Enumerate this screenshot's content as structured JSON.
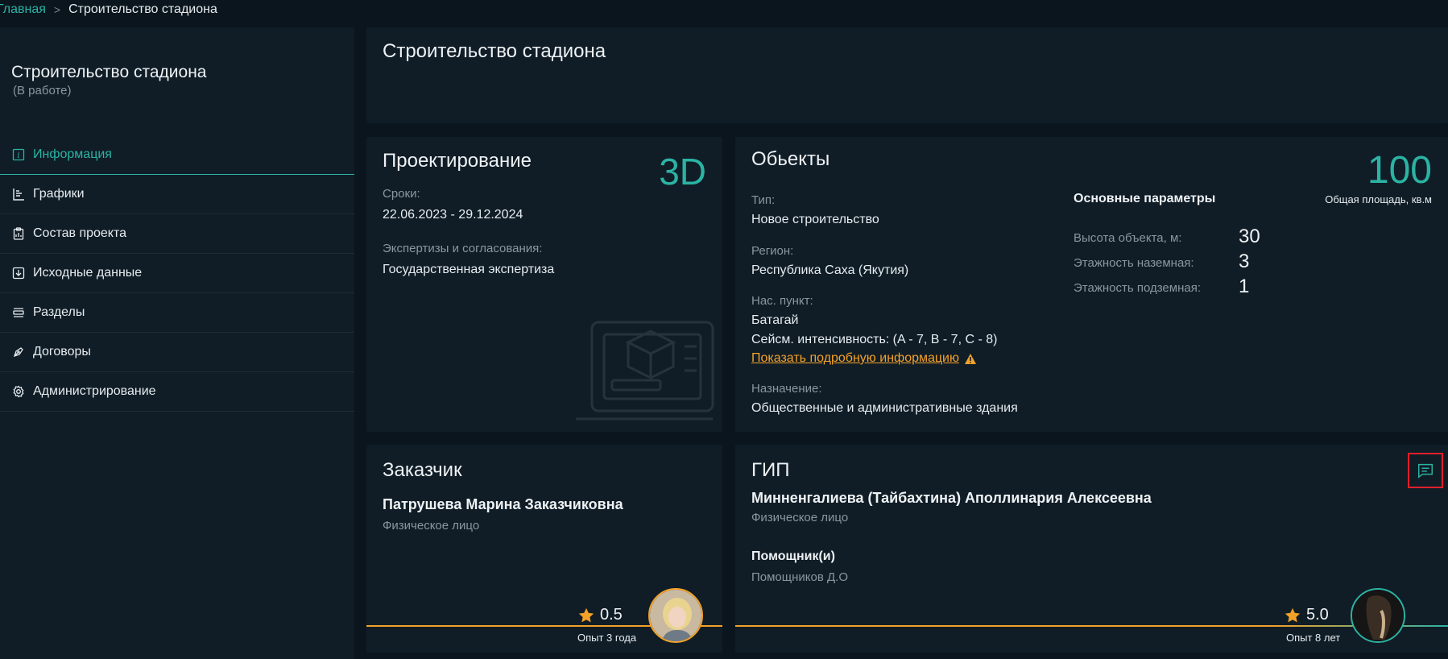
{
  "breadcrumb": {
    "home": "Главная",
    "separator": ">",
    "current": "Строительство стадиона"
  },
  "sidebar": {
    "title": "Строительство стадиона",
    "status": "(В работе)",
    "items": [
      {
        "label": "Информация",
        "icon": "info-icon"
      },
      {
        "label": "Графики",
        "icon": "gantt-icon"
      },
      {
        "label": "Состав проекта",
        "icon": "clipboard-icon"
      },
      {
        "label": "Исходные данные",
        "icon": "download-icon"
      },
      {
        "label": "Разделы",
        "icon": "layers-icon"
      },
      {
        "label": "Договоры",
        "icon": "pen-icon"
      },
      {
        "label": "Администрирование",
        "icon": "gear-icon"
      }
    ]
  },
  "header_card": {
    "title": "Строительство стадиона"
  },
  "design": {
    "title": "Проектирование",
    "badge": "3D",
    "dates_label": "Сроки:",
    "dates": "22.06.2023 - 29.12.2024",
    "expertise_label": "Экспертизы и согласования:",
    "expertise": "Государственная экспертиза"
  },
  "objects": {
    "title": "Обьекты",
    "area_value": "100",
    "area_label": "Общая площадь, кв.м",
    "type_label": "Тип:",
    "type": "Новое строительство",
    "region_label": "Регион:",
    "region": "Республика Саха (Якутия)",
    "settlement_label": "Нас. пункт:",
    "settlement": "Батагай",
    "seismic": "Сейсм. интенсивность: (A - 7, B - 7, C - 8)",
    "details_link": "Показать подробную информацию",
    "purpose_label": "Назначение:",
    "purpose": "Общественные и административные здания",
    "params_title": "Основные параметры",
    "params": [
      {
        "label": "Высота объекта, м:",
        "value": "30"
      },
      {
        "label": "Этажность наземная:",
        "value": "3"
      },
      {
        "label": "Этажность подземная:",
        "value": "1"
      }
    ]
  },
  "customer": {
    "title": "Заказчик",
    "name": "Патрушева Марина Заказчиковна",
    "type": "Физическое лицо",
    "rating": "0.5",
    "experience": "Опыт 3 года"
  },
  "gip": {
    "title": "ГИП",
    "name": "Минненгалиева (Тайбахтина) Аполлинария Алексеевна",
    "type": "Физическое лицо",
    "assistants_label": "Помощник(и)",
    "assistants": "Помощников Д.О",
    "rating": "5.0",
    "experience": "Опыт 8 лет"
  },
  "colors": {
    "accent": "#2bb3a3",
    "orange": "#f4a128",
    "bg": "#0a151d",
    "card": "#101d27",
    "highlight": "#e0202a"
  }
}
